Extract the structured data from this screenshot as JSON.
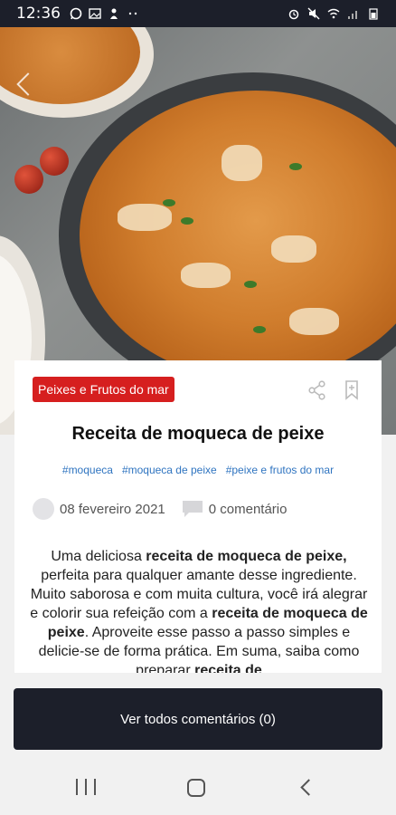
{
  "status_bar": {
    "time": "12:36",
    "left_icons": [
      "whatsapp-icon",
      "image-icon",
      "notification-icon",
      "more-dots-icon"
    ],
    "right_icons": [
      "alarm-icon",
      "mute-icon",
      "wifi-icon",
      "signal-icon",
      "battery-icon"
    ]
  },
  "article": {
    "category": "Peixes e Frutos do mar",
    "title": "Receita de moqueca de peixe",
    "tags": [
      "#moqueca",
      "#moqueca de peixe",
      "#peixe e frutos do mar"
    ],
    "date": "08 fevereiro 2021",
    "comments_count": "0 comentário",
    "body": {
      "p1_text1": "Uma deliciosa ",
      "p1_bold1": "receita de moqueca de peixe,",
      "p1_text2": " perfeita para qualquer amante desse ingrediente. Muito saborosa e com muita cultura, você irá alegrar e colorir sua refeição com a ",
      "p1_bold2": "receita de moqueca de peixe",
      "p1_text3": ". Aproveite esse passo a passo simples e delicie-se de forma prática. Em suma, saiba como preparar ",
      "p1_bold3": "receita de"
    }
  },
  "buttons": {
    "all_comments": "Ver todos comentários (0)"
  },
  "colors": {
    "badge": "#d61f1f",
    "tag": "#2f74c0",
    "dark": "#1c1f2a"
  }
}
